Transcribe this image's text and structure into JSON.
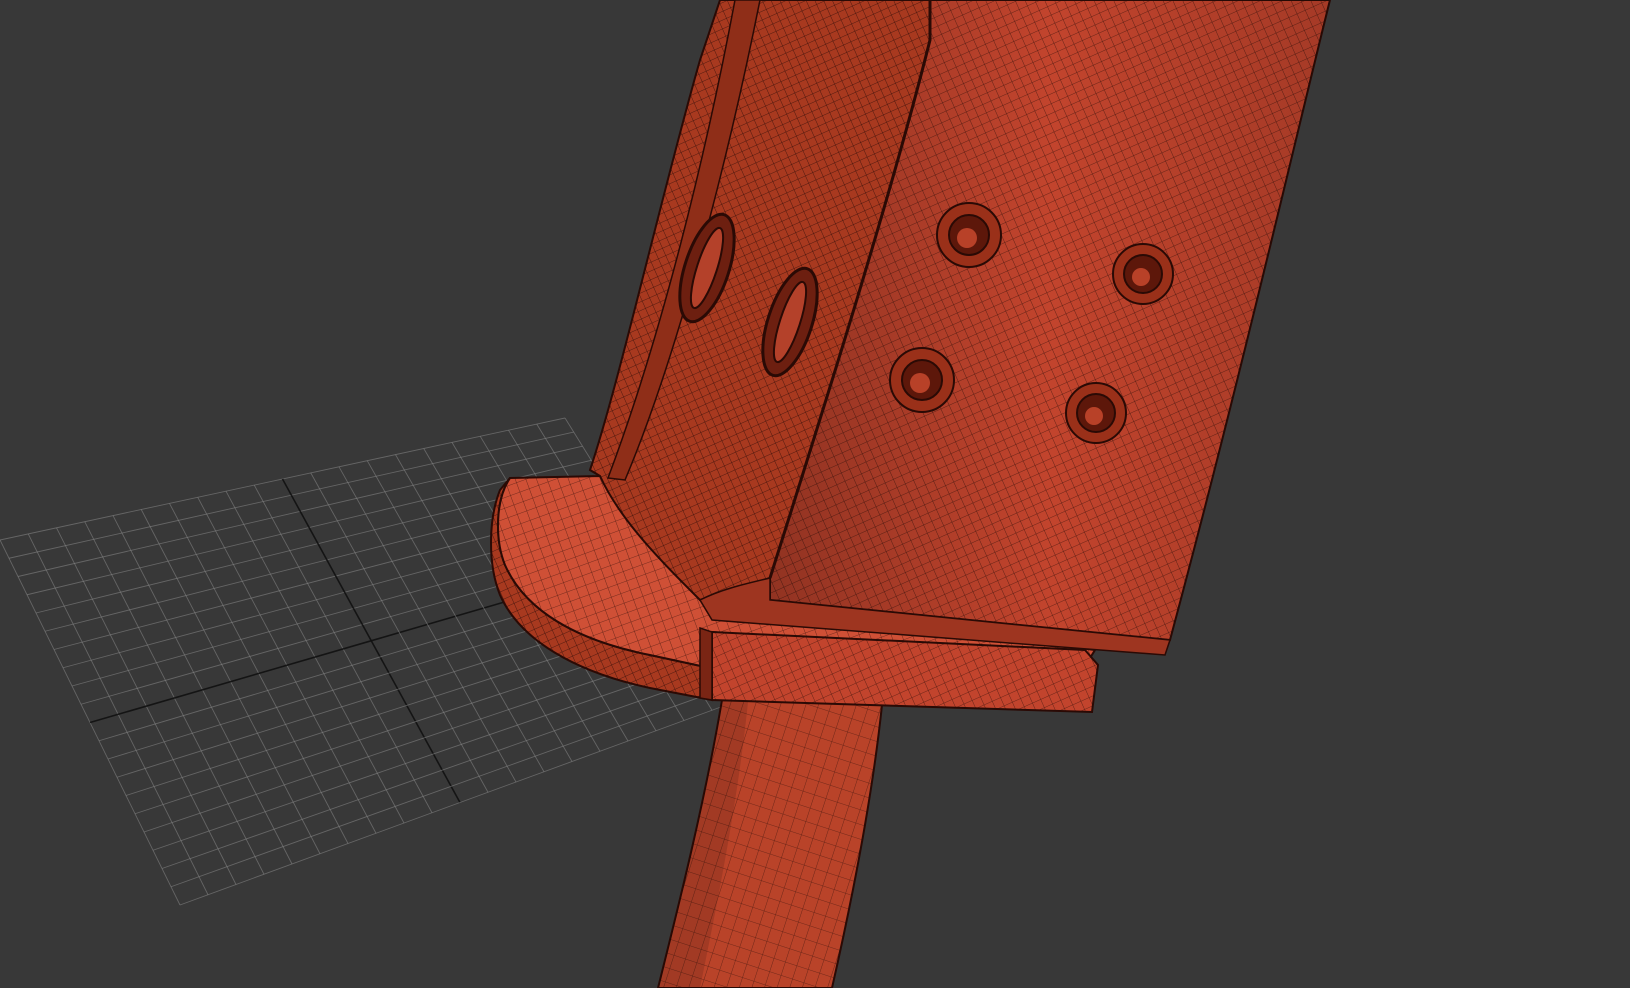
{
  "viewport": {
    "background_color": "#383838",
    "grid_color": "#8a8a8a",
    "grid_axis_color": "#111111",
    "model_color": "#c2442d",
    "wire_color": "#3a120c",
    "icon": "3d-wireframe-model"
  }
}
